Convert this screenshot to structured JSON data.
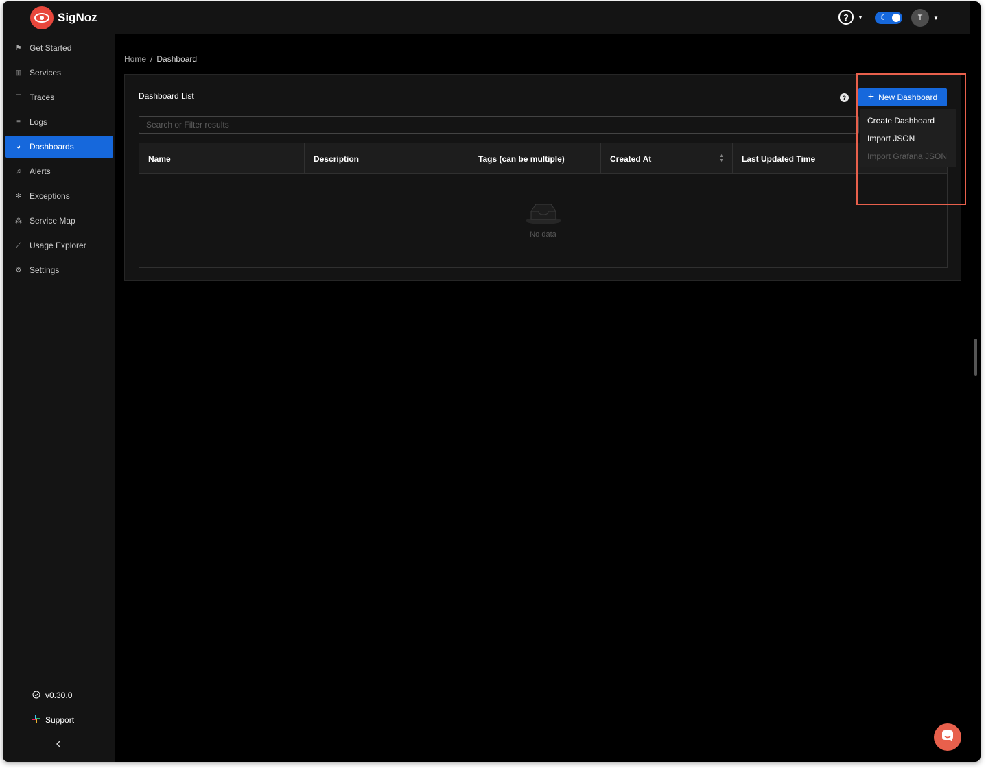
{
  "app": {
    "name": "SigNoz"
  },
  "sidebar": {
    "items": [
      {
        "label": "Get Started",
        "icon": "rocket-icon",
        "glyph": "⚑"
      },
      {
        "label": "Services",
        "icon": "bar-chart-icon",
        "glyph": "▥"
      },
      {
        "label": "Traces",
        "icon": "menu-lines-icon",
        "glyph": "☰"
      },
      {
        "label": "Logs",
        "icon": "align-left-icon",
        "glyph": "≡"
      },
      {
        "label": "Dashboards",
        "icon": "dashboard-icon",
        "glyph": "◕",
        "active": true
      },
      {
        "label": "Alerts",
        "icon": "alert-icon",
        "glyph": "♫"
      },
      {
        "label": "Exceptions",
        "icon": "bug-icon",
        "glyph": "✻"
      },
      {
        "label": "Service Map",
        "icon": "deployment-icon",
        "glyph": "⁂"
      },
      {
        "label": "Usage Explorer",
        "icon": "line-chart-icon",
        "glyph": "⟋"
      },
      {
        "label": "Settings",
        "icon": "gear-icon",
        "glyph": "⚙"
      }
    ],
    "version": "v0.30.0",
    "support": "Support"
  },
  "header": {
    "help_glyph": "?",
    "avatar_initial": "T"
  },
  "breadcrumb": {
    "home": "Home",
    "separator": "/",
    "current": "Dashboard"
  },
  "dashboard_list": {
    "title": "Dashboard List",
    "new_button_label": "New Dashboard",
    "search_placeholder": "Search or Filter results",
    "columns": [
      "Name",
      "Description",
      "Tags (can be multiple)",
      "Created At",
      "Last Updated Time"
    ],
    "empty_text": "No data"
  },
  "new_menu": {
    "items": [
      {
        "label": "Create Dashboard",
        "disabled": false
      },
      {
        "label": "Import JSON",
        "disabled": false
      },
      {
        "label": "Import Grafana JSON",
        "disabled": true
      }
    ]
  },
  "colors": {
    "accent": "#1668dc",
    "brand": "#e8473c",
    "highlight": "#e8604c"
  }
}
